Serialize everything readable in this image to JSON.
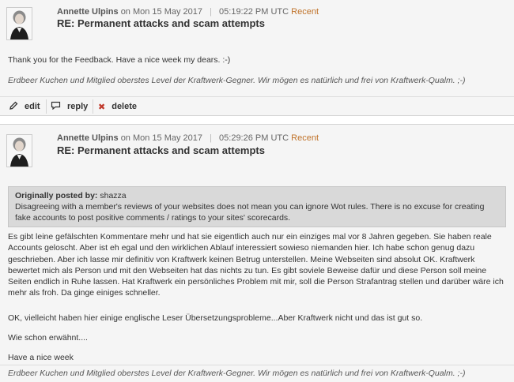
{
  "posts": [
    {
      "author": "Annette Ulpins",
      "date_text": "on Mon 15 May 2017",
      "time": "05:19:22 PM UTC",
      "recent_label": "Recent",
      "title": "RE: Permanent attacks and scam attempts",
      "body": "Thank you for the Feedback. Have a nice week my dears. :-)",
      "signature": "Erdbeer Kuchen und Mitglied oberstes Level der Kraftwerk-Gegner. Wir mögen es natürlich und frei von Kraftwerk-Qualm. ;-)",
      "actions": {
        "edit": "edit",
        "reply": "reply",
        "delete": "delete"
      }
    },
    {
      "author": "Annette Ulpins",
      "date_text": "on Mon 15 May 2017",
      "time": "05:29:26 PM UTC",
      "recent_label": "Recent",
      "title": "RE: Permanent attacks and scam attempts",
      "quote": {
        "label": "Originally posted by:",
        "quoted_author": "shazza",
        "text": "Disagreeing with a member's reviews of your websites does not mean you can ignore Wot rules. There is no excuse for creating fake accounts to post positive comments / ratings to your sites' scorecards."
      },
      "paragraphs": [
        "Es gibt leine gefälschten Kommentare mehr und hat sie eigentlich auch nur ein einziges mal vor 8 Jahren gegeben. Sie haben reale Accounts geloscht. Aber ist eh egal und den wirklichen Ablauf interessiert sowieso niemanden hier. Ich habe schon genug dazu geschrieben. Aber ich lasse mir definitiv von Kraftwerk keinen Betrug unterstellen. Meine Webseiten sind absolut OK. Kraftwerk bewertet mich als Person und mit den Webseiten hat das nichts zu tun. Es gibt soviele Beweise dafür und diese Person soll meine Seiten endlich in Ruhe lassen. Hat Kraftwerk ein persönliches Problem mit mir, soll die Person Strafantrag stellen und darüber wäre ich mehr als froh. Da ginge einiges schneller.",
        "OK, vielleicht haben hier einige englische Leser Übersetzungsprobleme...Aber Kraftwerk nicht und das ist gut so.",
        "Wie schon erwähnt....",
        "Have a nice week"
      ],
      "signature": "Erdbeer Kuchen und Mitglied oberstes Level der Kraftwerk-Gegner. Wir mögen es natürlich und frei von Kraftwerk-Qualm. ;-)"
    }
  ],
  "icons": {
    "edit": "pencil-icon",
    "reply": "speech-bubble-icon",
    "delete": "x-icon"
  },
  "colors": {
    "recent": "#c0732a",
    "delete_icon": "#c0392b",
    "quote_bg": "#d9d9d9",
    "post_bg": "#f5f5f5"
  }
}
